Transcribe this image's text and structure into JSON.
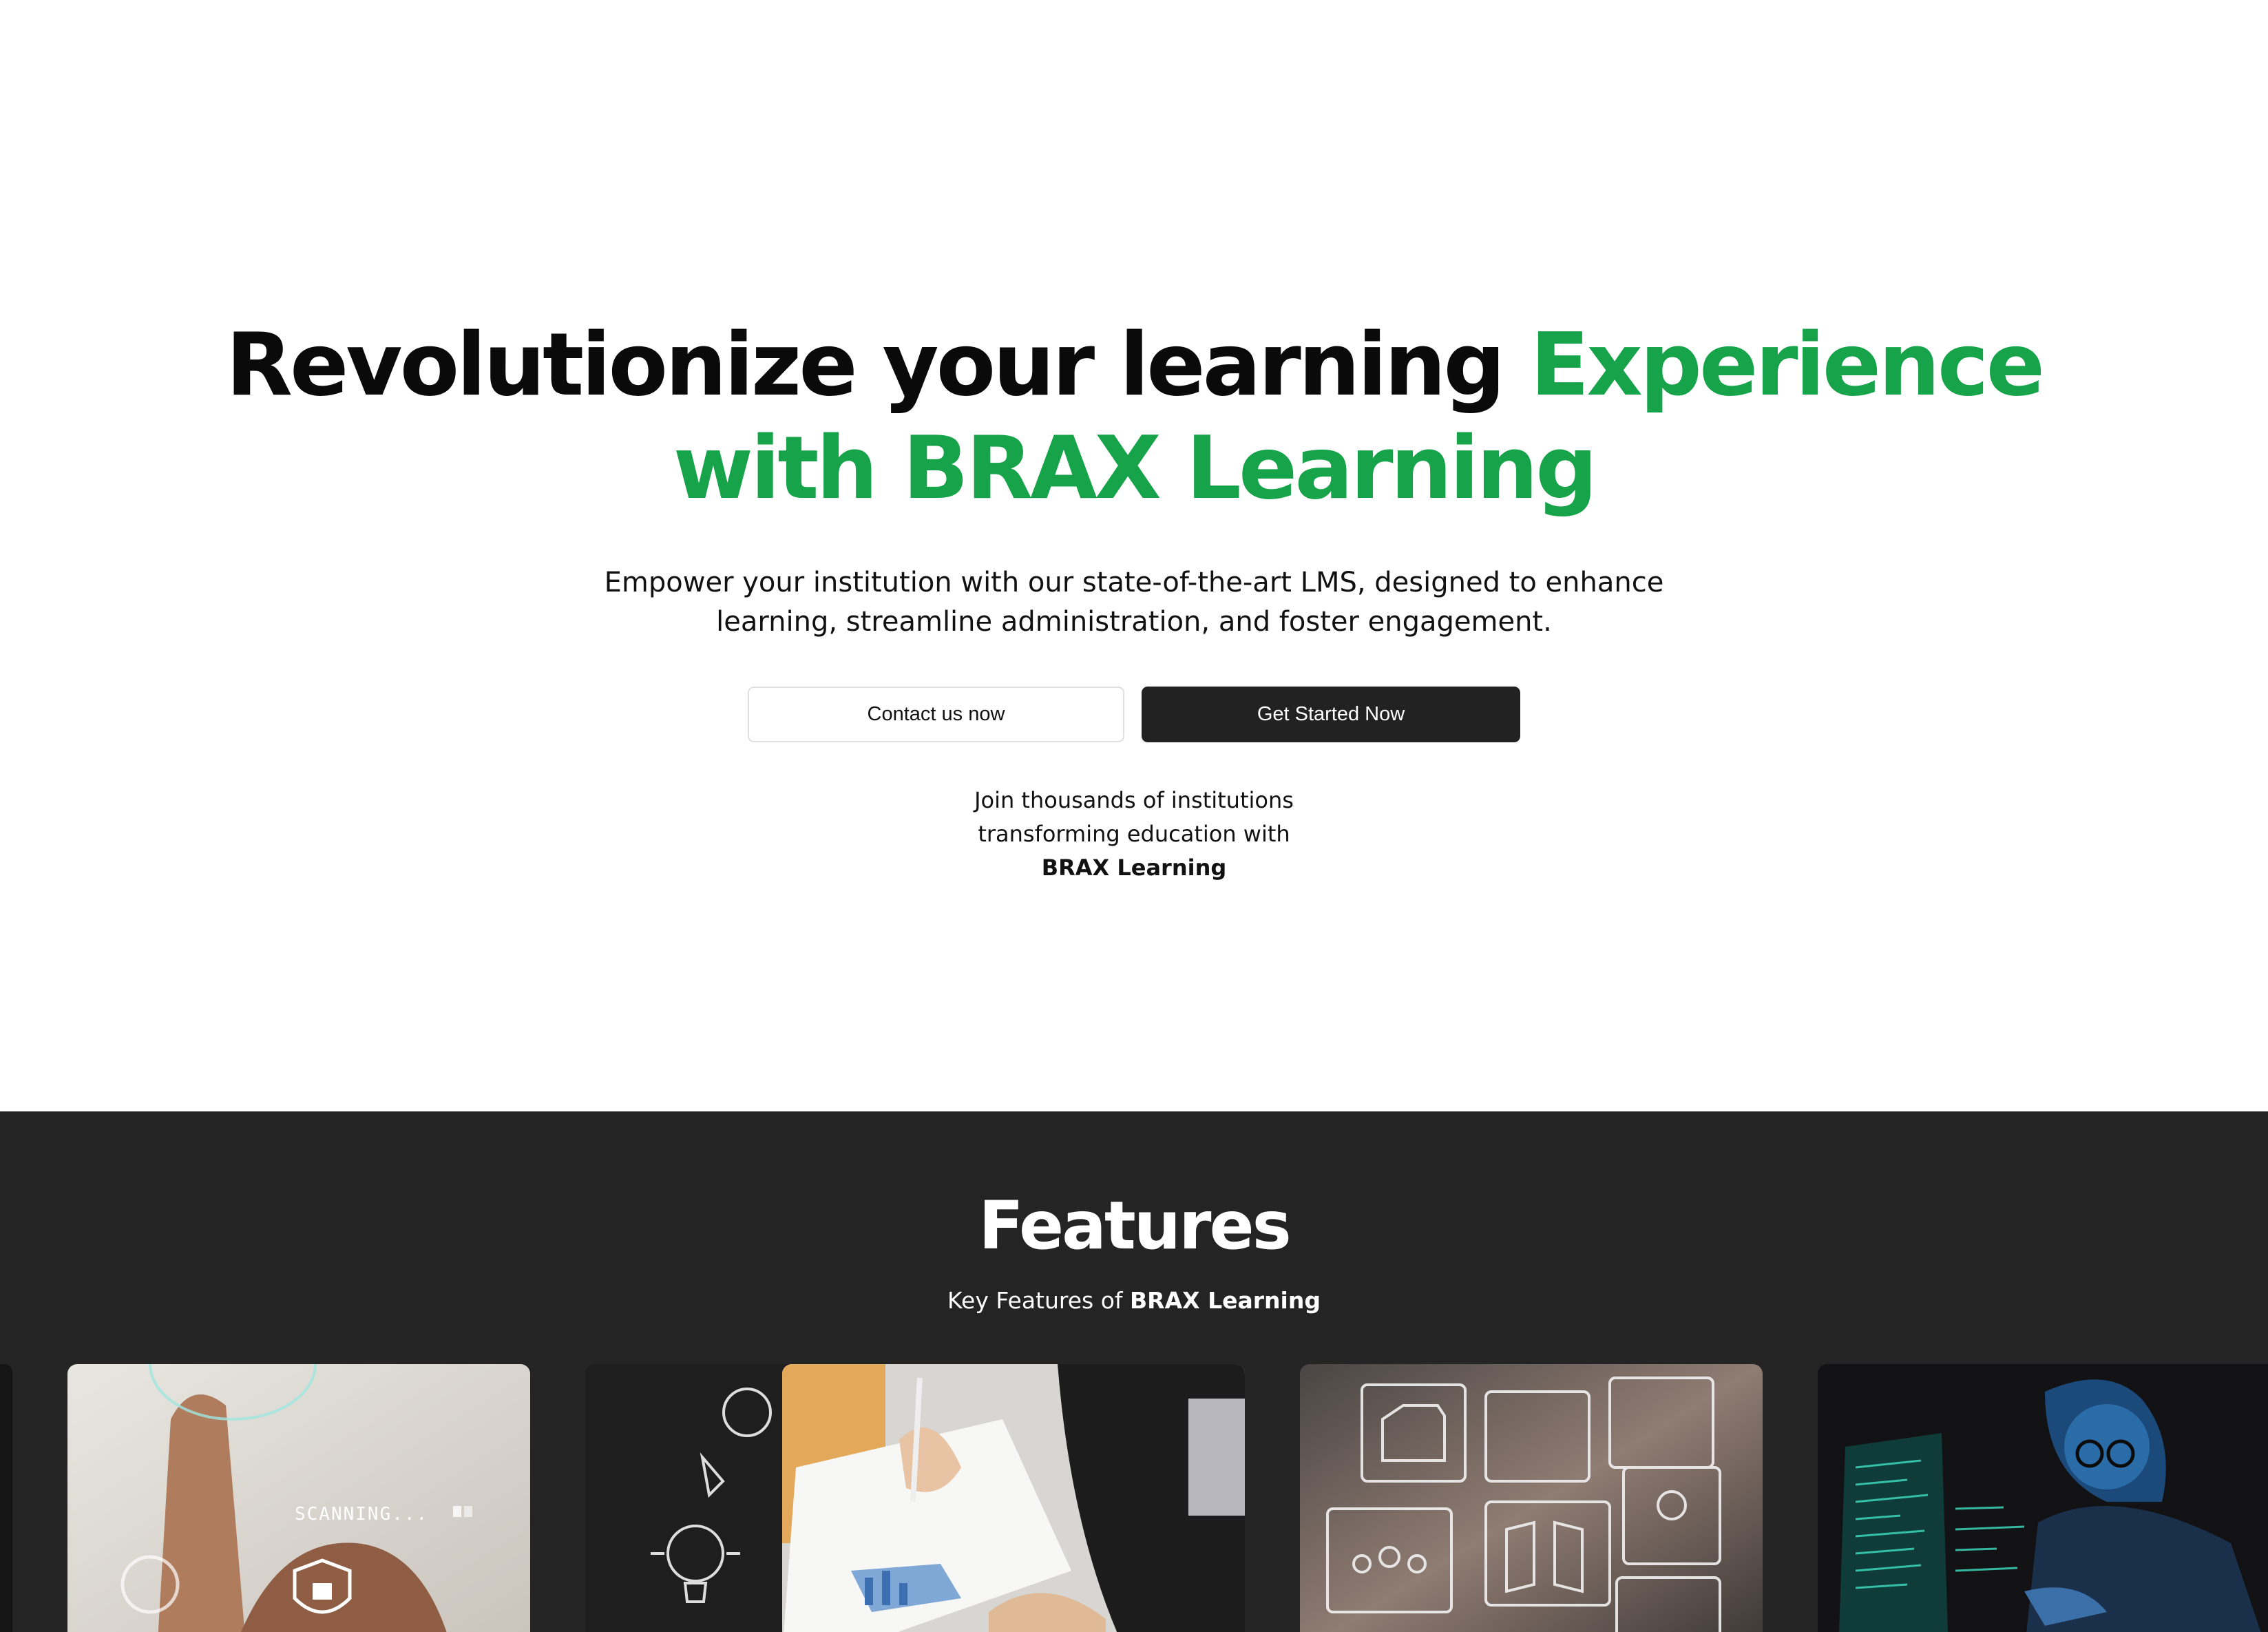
{
  "hero": {
    "title_dark": "Revolutionize your learning ",
    "title_accent_1": "Experience",
    "title_accent_2": "with BRAX Learning",
    "subtitle": "Empower your institution with our state-of-the-art LMS, designed to enhance learning, streamline administration, and foster engagement.",
    "contact_button": "Contact us now",
    "start_button": "Get Started Now",
    "join_line1": "Join thousands of institutions",
    "join_line2": "transforming education with",
    "join_brand": "BRAX Learning"
  },
  "features": {
    "title": "Features",
    "subtitle_prefix": "Key Features of ",
    "subtitle_brand": "BRAX Learning",
    "cards": [
      {
        "image": "fingerprint-scan-image",
        "overlay_text": "SCANNING..."
      },
      {
        "image": "chalkboard-ideas-image"
      },
      {
        "image": "document-signing-image"
      },
      {
        "image": "digital-files-interface-image"
      },
      {
        "image": "coding-student-image"
      }
    ]
  },
  "colors": {
    "accent": "#16a34a",
    "dark_button": "#222222",
    "features_bg": "#242424"
  }
}
